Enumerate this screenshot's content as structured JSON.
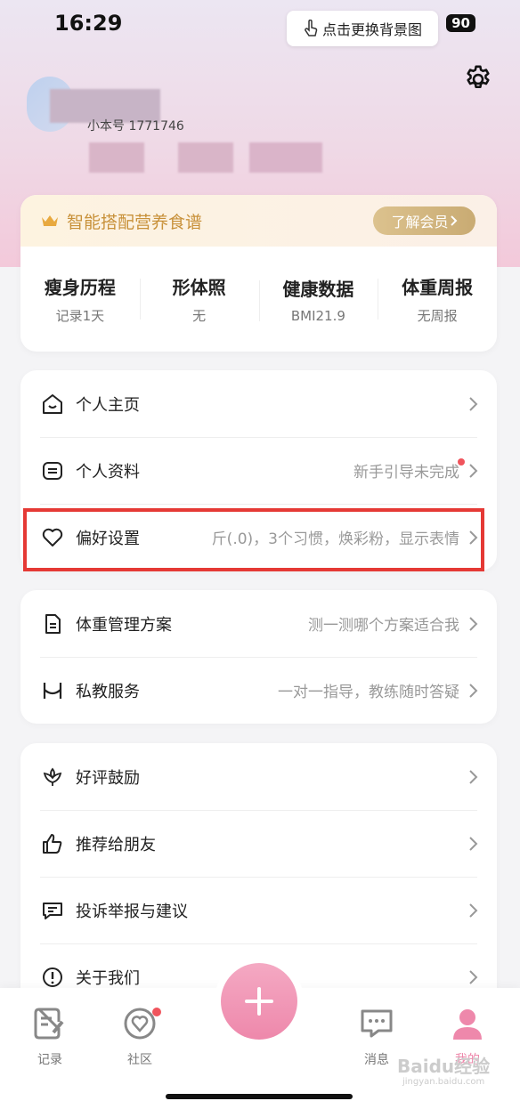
{
  "status_bar": {
    "time": "16:29",
    "battery": "90",
    "hint": "点击更换背景图"
  },
  "profile": {
    "id_text": "小本号 1771746"
  },
  "vip": {
    "title": "智能搭配营养食谱",
    "button": "了解会员"
  },
  "stats": [
    {
      "title": "瘦身历程",
      "sub": "记录1天"
    },
    {
      "title": "形体照",
      "sub": "无"
    },
    {
      "title": "健康数据",
      "sub": "BMI21.9"
    },
    {
      "title": "体重周报",
      "sub": "无周报"
    }
  ],
  "menu1": [
    {
      "label": "个人主页",
      "value": "",
      "icon": "home-face-icon"
    },
    {
      "label": "个人资料",
      "value": "新手引导未完成",
      "icon": "profile-card-icon"
    },
    {
      "label": "偏好设置",
      "value": "斤(.0)，3个习惯，焕彩粉，显示表情",
      "icon": "heart-icon"
    }
  ],
  "menu2": [
    {
      "label": "体重管理方案",
      "value": "测一测哪个方案适合我",
      "icon": "document-icon"
    },
    {
      "label": "私教服务",
      "value": "一对一指导，教练随时答疑",
      "icon": "coach-icon"
    }
  ],
  "menu3": [
    {
      "label": "好评鼓励",
      "value": "",
      "icon": "flower-icon"
    },
    {
      "label": "推荐给朋友",
      "value": "",
      "icon": "thumbs-up-icon"
    },
    {
      "label": "投诉举报与建议",
      "value": "",
      "icon": "message-icon"
    },
    {
      "label": "关于我们",
      "value": "",
      "icon": "info-icon"
    }
  ],
  "tabbar": {
    "record": "记录",
    "community": "社区",
    "messages": "消息",
    "mine": "我的"
  },
  "colors": {
    "accent_pink": "#ee88ab",
    "highlight_red": "#e53935",
    "vip_gold": "#c8913a"
  },
  "watermark": {
    "main": "Baidu经验",
    "sub": "jingyan.baidu.com"
  }
}
